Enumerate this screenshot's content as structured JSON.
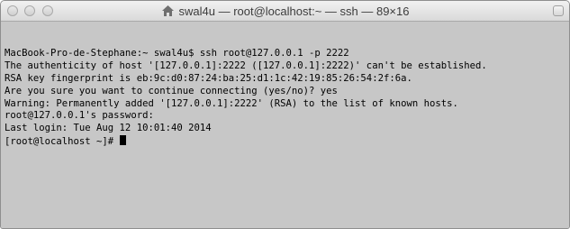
{
  "window": {
    "title": "swal4u — root@localhost:~ — ssh — 89×16"
  },
  "colors": {
    "terminal_background": "#c7c7c7",
    "terminal_foreground": "#000000"
  },
  "terminal": {
    "lines": [
      "MacBook-Pro-de-Stephane:~ swal4u$ ssh root@127.0.0.1 -p 2222",
      "The authenticity of host '[127.0.0.1]:2222 ([127.0.0.1]:2222)' can't be established.",
      "RSA key fingerprint is eb:9c:d0:87:24:ba:25:d1:1c:42:19:85:26:54:2f:6a.",
      "Are you sure you want to continue connecting (yes/no)? yes",
      "Warning: Permanently added '[127.0.0.1]:2222' (RSA) to the list of known hosts.",
      "root@127.0.0.1's password:",
      "Last login: Tue Aug 12 10:01:40 2014",
      "[root@localhost ~]# "
    ]
  }
}
